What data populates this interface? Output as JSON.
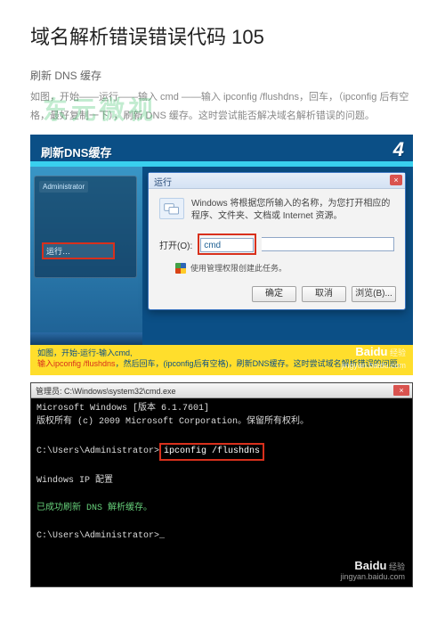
{
  "title": "域名解析错误错误代码 105",
  "subtitle": "刷新 DNS 缓存",
  "desc": "如图，开始——运行——输入 cmd ——输入 ipconfig  /flushdns，回车，（ipconfig 后有空格，最好复制一下），刷新 DNS 缓存。这时尝试能否解决域名解析错误的问题。",
  "watermark": "东元微视",
  "fig1": {
    "header": "刷新DNS缓存",
    "num": "4",
    "start_admin": "Administrator",
    "sm_runitem": "运行…",
    "run": {
      "title": "运行",
      "hint": "Windows 将根据您所输入的名称，为您打开相应的程序、文件夹、文档或 Internet 资源。",
      "open_label": "打开(O):",
      "input_value": "cmd",
      "admin_hint": "使用管理权限创建此任务。",
      "ok": "确定",
      "cancel": "取消",
      "browse": "浏览(B)..."
    },
    "yellow_line1": "如图，开始-运行-输入cmd,",
    "yellow_line2_a": "输入ipconfig /flushdns",
    "yellow_line2_b": "，然后回车，(ipconfig后有空格)，刷新DNS缓存。这时尝试域名解析错误的问题。",
    "logo_brand": "Baidu",
    "logo_sub": "经验",
    "logo_url": "jingyan.baidu.com"
  },
  "fig2": {
    "title": "管理员: C:\\Windows\\system32\\cmd.exe",
    "line1": "Microsoft Windows [版本 6.1.7601]",
    "line2": "版权所有 (c) 2009 Microsoft Corporation。保留所有权利。",
    "prompt1": "C:\\Users\\Administrator>",
    "cmd_hl": "ipconfig /flushdns",
    "line_cfg": "Windows IP 配置",
    "line_ok": "已成功刷新 DNS 解析缓存。",
    "prompt2": "C:\\Users\\Administrator>",
    "logo_brand": "Baidu",
    "logo_sub": "经验",
    "logo_url": "jingyan.baidu.com"
  }
}
